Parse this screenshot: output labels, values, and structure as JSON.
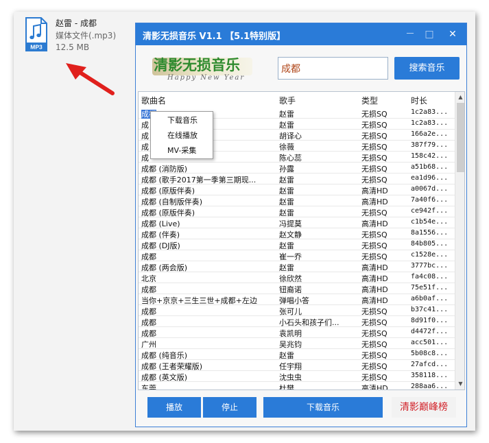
{
  "file": {
    "name": "赵雷 - 成都",
    "type": "媒体文件(.mp3)",
    "size": "12.5 MB",
    "badge": "MP3",
    "icon": "music-file-icon"
  },
  "window": {
    "title": "清影无损音乐  V1.1 【5.1特别版】",
    "minimize": "－",
    "maximize": "□",
    "close": "✕"
  },
  "logo": {
    "text": "清影无损音乐",
    "subtitle": "Happy New Year"
  },
  "search": {
    "value": "成都",
    "button": "搜索音乐"
  },
  "columns": [
    "歌曲名",
    "歌手",
    "类型",
    "时长"
  ],
  "rows": [
    {
      "name": "成都",
      "artist": "赵雷",
      "type": "无损SQ",
      "dur": "1c2a83..."
    },
    {
      "name": "成",
      "artist": "赵雷",
      "type": "无损SQ",
      "dur": "1c2a83..."
    },
    {
      "name": "成",
      "artist": "胡译心",
      "type": "无损SQ",
      "dur": "166a2e..."
    },
    {
      "name": "成",
      "artist": "徐薇",
      "type": "无损SQ",
      "dur": "387f79..."
    },
    {
      "name": "成",
      "artist": "陈心蕊",
      "type": "无损SQ",
      "dur": "158c42..."
    },
    {
      "name": "成都 (消防版)",
      "artist": "孙露",
      "type": "无损SQ",
      "dur": "a51b68..."
    },
    {
      "name": "成都 (歌手2017第一季第三期现...",
      "artist": "赵雷",
      "type": "无损SQ",
      "dur": "ea1d96..."
    },
    {
      "name": "成都 (原版伴奏)",
      "artist": "赵雷",
      "type": "高清HD",
      "dur": "a0067d..."
    },
    {
      "name": "成都 (自制版伴奏)",
      "artist": "赵雷",
      "type": "高清HD",
      "dur": "7a40f6..."
    },
    {
      "name": "成都 (原版伴奏)",
      "artist": "赵雷",
      "type": "无损SQ",
      "dur": "ce942f..."
    },
    {
      "name": "成都 (Live)",
      "artist": "冯提莫",
      "type": "高清HD",
      "dur": "c1b54e..."
    },
    {
      "name": "成都 (伴奏)",
      "artist": "赵文静",
      "type": "无损SQ",
      "dur": "8a1556..."
    },
    {
      "name": "成都 (DJ版)",
      "artist": "赵雷",
      "type": "无损SQ",
      "dur": "84b805..."
    },
    {
      "name": "成都",
      "artist": "崔一乔",
      "type": "无损SQ",
      "dur": "c1528e..."
    },
    {
      "name": "成都 (两会版)",
      "artist": "赵雷",
      "type": "高清HD",
      "dur": "3777bc..."
    },
    {
      "name": "北京",
      "artist": "徐欣然",
      "type": "高清HD",
      "dur": "fa4c08..."
    },
    {
      "name": "成都",
      "artist": "钮裔诺",
      "type": "高清HD",
      "dur": "75e51f..."
    },
    {
      "name": "当你+京京+三生三世+成都+左边",
      "artist": "弹唱小答",
      "type": "高清HD",
      "dur": "a6b0af..."
    },
    {
      "name": "成都",
      "artist": "张可儿",
      "type": "无损SQ",
      "dur": "b37c41..."
    },
    {
      "name": "成都",
      "artist": "小石头和孩子们...",
      "type": "无损SQ",
      "dur": "8d91f0..."
    },
    {
      "name": "成都",
      "artist": "袁凯明",
      "type": "无损SQ",
      "dur": "d4472f..."
    },
    {
      "name": "广州",
      "artist": "吴兆钧",
      "type": "无损SQ",
      "dur": "acc501..."
    },
    {
      "name": "成都 (纯音乐)",
      "artist": "赵雷",
      "type": "无损SQ",
      "dur": "5b08c8..."
    },
    {
      "name": "成都 (王者荣耀版)",
      "artist": "任宇翔",
      "type": "无损SQ",
      "dur": "27afcd..."
    },
    {
      "name": "成都 (英文版)",
      "artist": "沈虫虫",
      "type": "无损SQ",
      "dur": "358118..."
    },
    {
      "name": "东莞",
      "artist": "杜樊",
      "type": "高清HD",
      "dur": "288aa6..."
    }
  ],
  "context_menu": [
    "下载音乐",
    "在线播放",
    "MV-采集"
  ],
  "bottom": {
    "play": "播放",
    "stop": "停止",
    "download": "下载音乐",
    "rank": "清影巅峰榜"
  },
  "colors": {
    "accent": "#2a7bd8",
    "rank": "#d2232a",
    "arrow": "#e0201c"
  }
}
